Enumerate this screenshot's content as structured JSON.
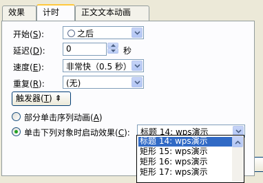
{
  "tabs": [
    {
      "label": "效果"
    },
    {
      "label": "计时"
    },
    {
      "label": "正文文本动画"
    }
  ],
  "fields": {
    "start": {
      "label": "开始",
      "hotkey": "S",
      "value": "之后"
    },
    "delay": {
      "label": "延迟",
      "hotkey": "D",
      "value": "0",
      "unit": "秒"
    },
    "speed": {
      "label": "速度",
      "hotkey": "E",
      "value": "非常快（0.5 秒）"
    },
    "repeat": {
      "label": "重复",
      "hotkey": "R",
      "value": "(无)"
    }
  },
  "trigger_button": {
    "label": "触发器",
    "hotkey": "T",
    "arrow": "⇞"
  },
  "radios": [
    {
      "label": "部分单击序列动画",
      "hotkey": "A",
      "checked": false
    },
    {
      "label": "单击下列对象时启动效果",
      "hotkey": "C",
      "checked": true
    }
  ],
  "trigger_object": {
    "value": "标题 14: wps演示"
  },
  "dropdown_items": [
    {
      "label": "标题 14: wps演示",
      "selected": true
    },
    {
      "label": "矩形 15: wps演示",
      "selected": false
    },
    {
      "label": "矩形 16: wps演示",
      "selected": false
    },
    {
      "label": "矩形 17: wps演示",
      "selected": false
    }
  ],
  "colors": {
    "accent": "#316ac5",
    "tab_highlight": "#ffc83c",
    "radio_dot": "#21a121"
  }
}
